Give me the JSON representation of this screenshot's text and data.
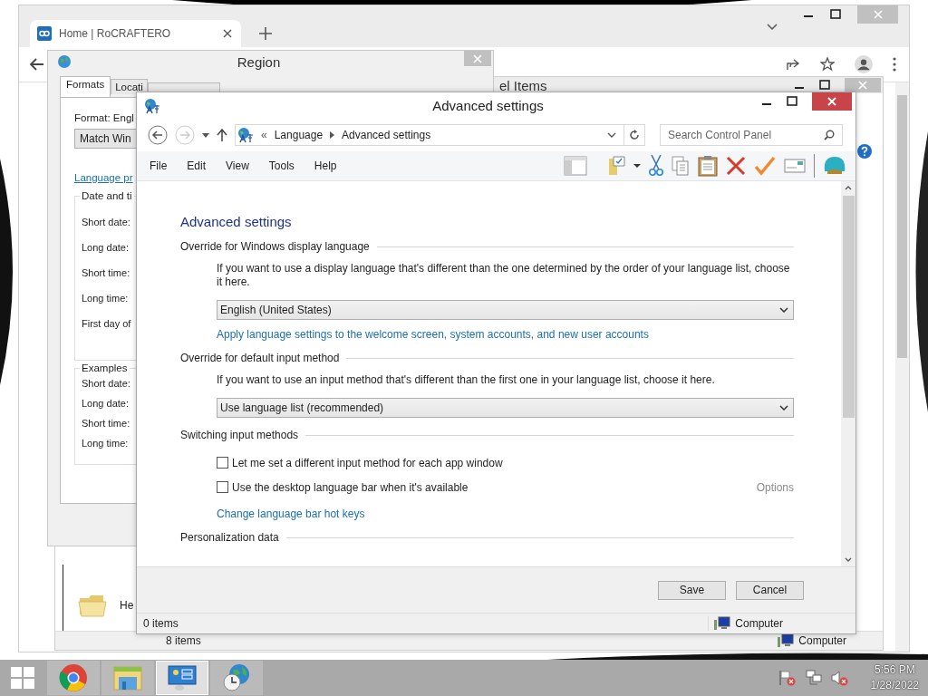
{
  "browser": {
    "tab": {
      "title": "Home | RoCRAFTERO",
      "selected": true
    }
  },
  "control_panel_window": {
    "title": "el Items",
    "item_label": "He",
    "status_count": "8 items",
    "status_location": "Computer"
  },
  "region_dialog": {
    "title": "Region",
    "tabs": [
      {
        "label": "Formats",
        "selected": true
      },
      {
        "label": "Locati",
        "selected": false
      }
    ],
    "format_label": "Format: Engl",
    "format_value": "Match Win",
    "link": "Language pr",
    "date_group": {
      "title": "Date and ti",
      "labels": [
        "Short date:",
        "Long date:",
        "Short time:",
        "Long time:",
        "First day of"
      ]
    },
    "examples_group": {
      "title": "Examples",
      "labels": [
        "Short date:",
        "Long date:",
        "Short time:",
        "Long time:"
      ]
    }
  },
  "advanced_window": {
    "title": "Advanced settings",
    "forward_disabled": true,
    "breadcrumb": [
      "Language",
      "Advanced settings"
    ],
    "breadcrumb_prefix": "«",
    "search": {
      "placeholder": "Search Control Panel"
    },
    "menu": [
      "File",
      "Edit",
      "View",
      "Tools",
      "Help"
    ],
    "heading": "Advanced settings",
    "sections": [
      {
        "title": "Override for Windows display language",
        "items": [
          {
            "kind": "text",
            "text": "If you want to use a display language that's different than the one determined by the order of your language list, choose it here."
          },
          {
            "kind": "dropdown",
            "value": "English (United States)"
          },
          {
            "kind": "link",
            "text": "Apply language settings to the welcome screen, system accounts, and new user accounts"
          }
        ]
      },
      {
        "title": "Override for default input method",
        "items": [
          {
            "kind": "text",
            "text": "If you want to use an input method that's different than the first one in your language list, choose it here."
          },
          {
            "kind": "dropdown",
            "value": "Use language list (recommended)"
          }
        ]
      },
      {
        "title": "Switching input methods",
        "items": [
          {
            "kind": "checkbox",
            "label": "Let me set a different input method for each app window",
            "checked": false
          },
          {
            "kind": "checkbox",
            "label": "Use the desktop language bar when it's available",
            "checked": false,
            "option": {
              "label": "Options",
              "disabled": true
            }
          },
          {
            "kind": "link",
            "text": "Change language bar hot keys"
          }
        ]
      },
      {
        "title": "Personalization data"
      }
    ],
    "buttons": [
      "Save",
      "Cancel"
    ],
    "status_count": "0 items",
    "status_location": "Computer"
  },
  "taskbar": {
    "apps": [
      {
        "kind": "browser",
        "selected": false
      },
      {
        "kind": "explorer",
        "selected": false
      },
      {
        "kind": "control-panel",
        "selected": true
      },
      {
        "kind": "date-time",
        "selected": false
      }
    ],
    "time": "5:56 PM",
    "date": "1/28/2022"
  }
}
